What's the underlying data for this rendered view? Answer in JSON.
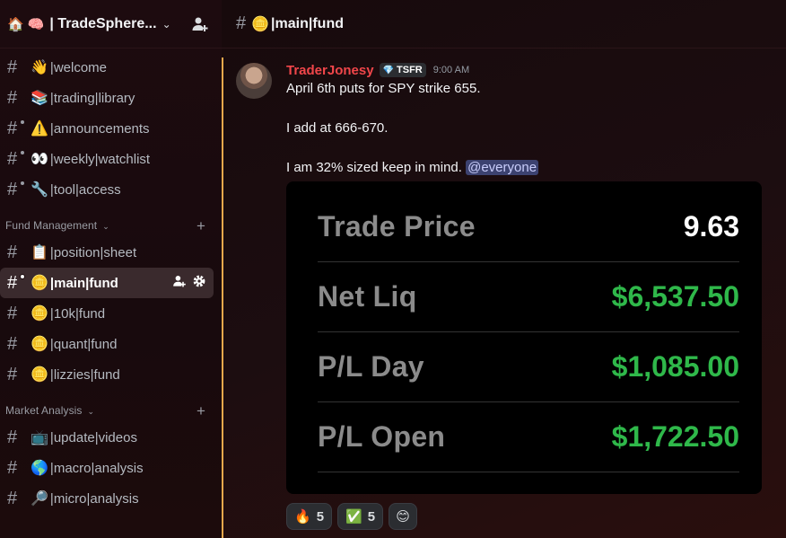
{
  "server": {
    "name": "| TradeSphere...",
    "emojis": [
      "🏠",
      "🧠"
    ],
    "chevron": "⌄"
  },
  "channels_top": [
    {
      "emoji": "👋",
      "name": "|welcome"
    },
    {
      "emoji": "📚",
      "name": "|trading|library"
    },
    {
      "emoji": "⚠️",
      "name": "|announcements"
    },
    {
      "emoji": "👀",
      "name": "|weekly|watchlist"
    },
    {
      "emoji": "🔧",
      "name": "|tool|access"
    }
  ],
  "categories": {
    "fund": {
      "label": "Fund Management",
      "chevron": "⌄",
      "plus": "+"
    },
    "market": {
      "label": "Market Analysis",
      "chevron": "⌄",
      "plus": "+"
    }
  },
  "channels_fund": [
    {
      "emoji": "📋",
      "name": "|position|sheet"
    },
    {
      "emoji": "🪙",
      "name": "|main|fund"
    },
    {
      "emoji": "🪙",
      "name": "|10k|fund"
    },
    {
      "emoji": "🪙",
      "name": "|quant|fund"
    },
    {
      "emoji": "🪙",
      "name": "|lizzies|fund"
    }
  ],
  "channels_market": [
    {
      "emoji": "📺",
      "name": "|update|videos"
    },
    {
      "emoji": "🌎",
      "name": "|macro|analysis"
    },
    {
      "emoji": "🔎",
      "name": "|micro|analysis"
    }
  ],
  "topbar": {
    "emoji": "🪙",
    "name": "|main|fund"
  },
  "message": {
    "username": "TraderJonesy",
    "tag": "TSFR",
    "tag_icon": "💎",
    "time": "9:00 AM",
    "lines": [
      "April 6th puts for SPY strike 655.",
      "I add at 666-670.",
      "I am 32% sized keep in mind."
    ],
    "mention": "@everyone"
  },
  "trade_card": {
    "rows": [
      {
        "label": "Trade Price",
        "value": "9.63"
      },
      {
        "label": "Net Liq",
        "value": "$6,537.50"
      },
      {
        "label": "P/L Day",
        "value": "$1,085.00"
      },
      {
        "label": "P/L Open",
        "value": "$1,722.50"
      }
    ]
  },
  "reactions": [
    {
      "emoji": "🔥",
      "count": "5"
    },
    {
      "emoji": "✅",
      "count": "5"
    }
  ],
  "add_reaction_icon": "😊"
}
